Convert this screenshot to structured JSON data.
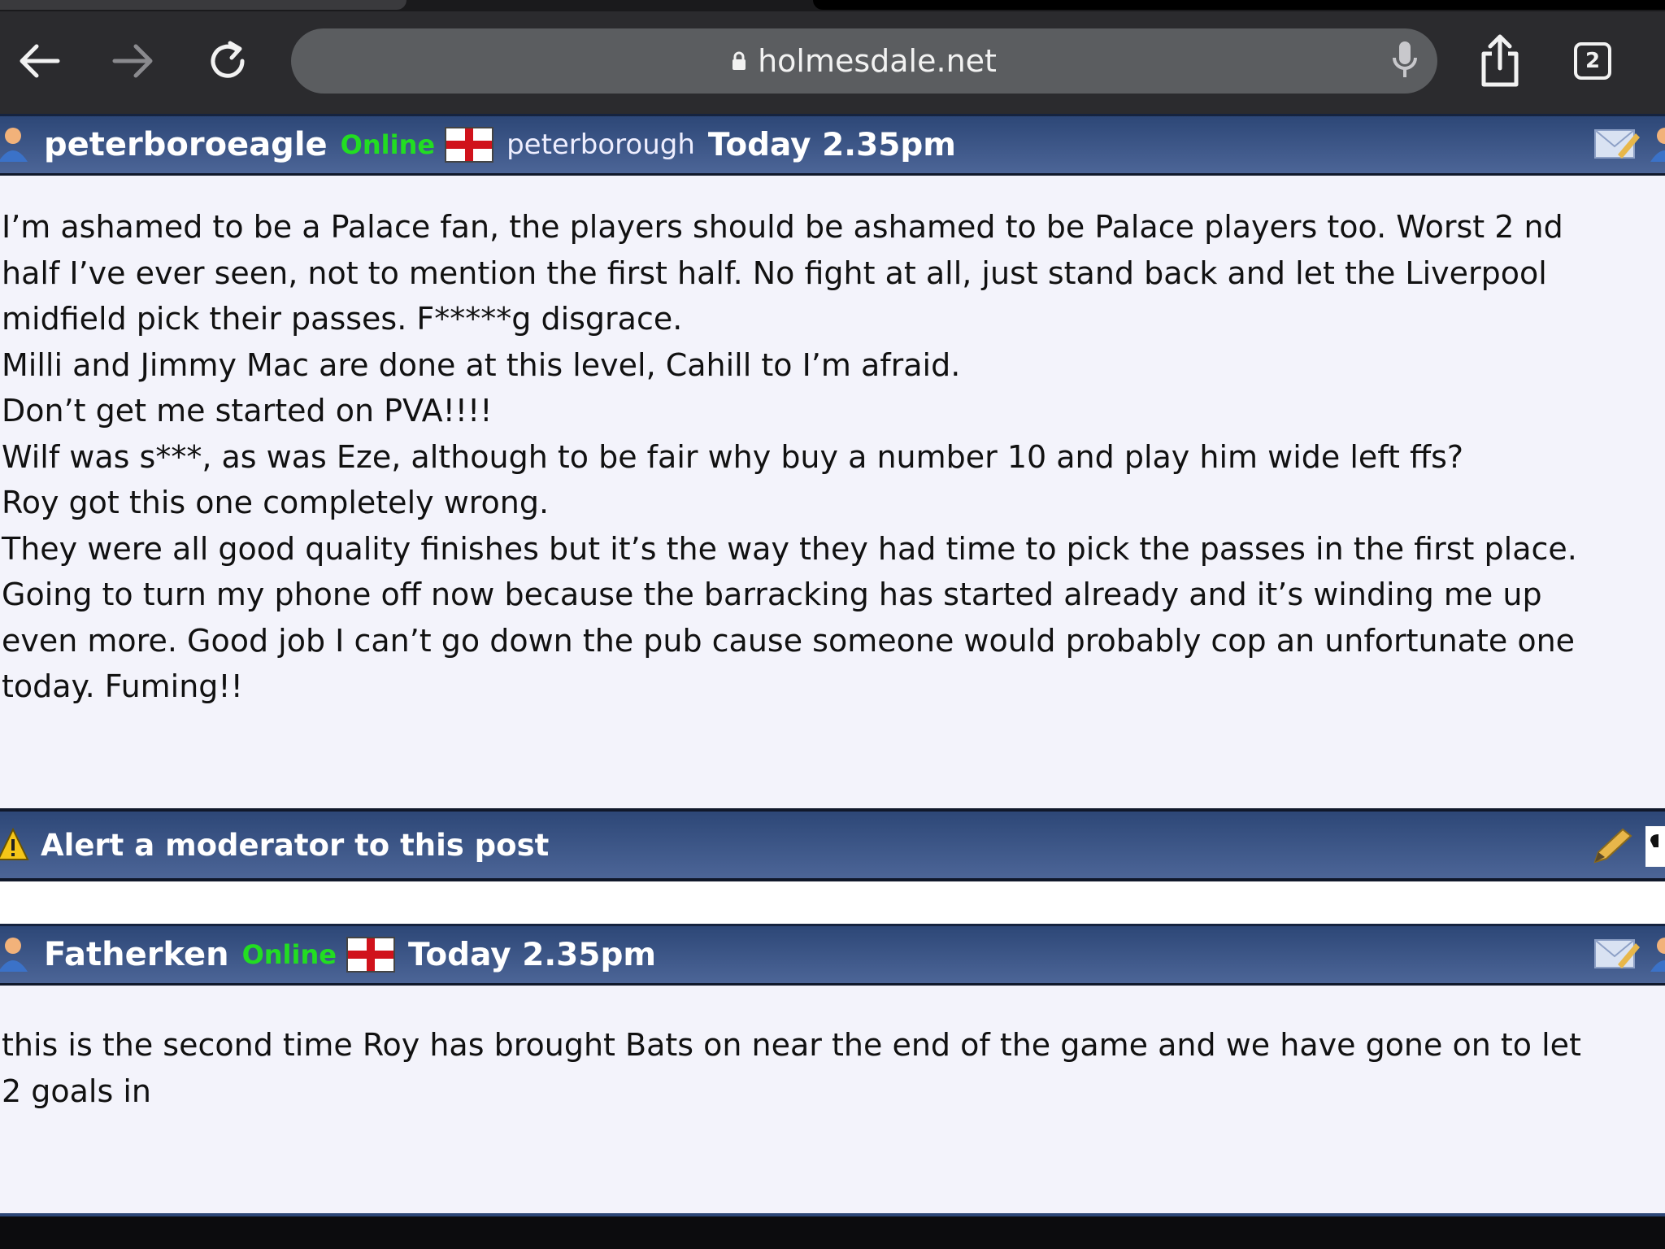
{
  "browser": {
    "url": "holmesdale.net",
    "tab_count": "2"
  },
  "posts": [
    {
      "username": "peterboroeagle",
      "status": "Online",
      "location": "peterborough",
      "time": "Today 2.35pm",
      "lines": [
        "I’m ashamed to be a Palace fan, the players should be ashamed to be Palace players too. Worst 2 nd",
        "half I’ve ever seen, not to mention the first half. No fight at all, just stand back and let the Liverpool",
        "midfield pick their passes. F*****g disgrace.",
        "Milli and Jimmy Mac are done at this level, Cahill to I’m afraid.",
        "Don’t get me started on PVA!!!!",
        "Wilf was s***, as was Eze, although to be fair why buy a number 10 and play him wide left ffs?",
        "Roy got this one completely wrong.",
        "They were all good quality finishes but it’s the way they had time to pick the passes in the first place.",
        "Going to turn my phone off now because the barracking has started already and it’s winding me up",
        "even more. Good job I can’t go down the pub cause someone would probably cop an unfortunate one",
        "today. Fuming!!"
      ]
    },
    {
      "username": "Fatherken",
      "status": "Online",
      "time": "Today 2.35pm",
      "lines": [
        "this is the second time Roy has brought Bats on near the end of the game and we have gone on to let",
        "2 goals in"
      ]
    }
  ],
  "alert": {
    "label": "Alert a moderator to this post"
  },
  "colors": {
    "header_gradient_top": "#2d4777",
    "header_gradient_bottom": "#4c6597",
    "online": "#22dd22",
    "body_bg": "#f3f3fb"
  }
}
